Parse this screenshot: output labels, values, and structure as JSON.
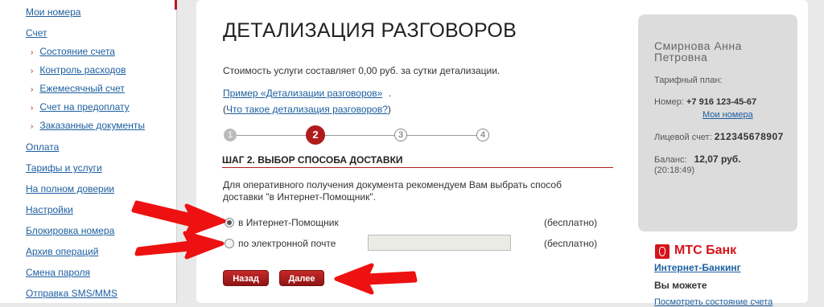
{
  "sidebar": {
    "items": [
      {
        "label": "Мои номера"
      },
      {
        "label": "Счет"
      },
      {
        "label": "Состояние счета"
      },
      {
        "label": "Контроль расходов"
      },
      {
        "label": "Ежемесячный счет"
      },
      {
        "label": "Счет на предоплату"
      },
      {
        "label": "Заказанные документы"
      },
      {
        "label": "Оплата"
      },
      {
        "label": "Тарифы и услуги"
      },
      {
        "label": "На полном доверии"
      },
      {
        "label": "Настройки"
      },
      {
        "label": "Блокировка номера"
      },
      {
        "label": "Архив операций"
      },
      {
        "label": "Смена пароля"
      },
      {
        "label": "Отправка SMS/MMS"
      }
    ]
  },
  "main": {
    "title": "ДЕТАЛИЗАЦИЯ РАЗГОВОРОВ",
    "cost_text": "Стоимость услуги составляет 0,00 руб. за сутки детализации.",
    "example_link": "Пример «Детализации разговоров»",
    "example_suffix": ".",
    "what_is_open": "(",
    "what_is_link": "Что такое детализация разговоров?",
    "what_is_close": ")",
    "steps": [
      "1",
      "2",
      "3",
      "4"
    ],
    "step_title": "ШАГ 2. ВЫБОР СПОСОБА ДОСТАВКИ",
    "recommend_line1": "Для оперативного получения документа рекомендуем Вам выбрать способ",
    "recommend_line2": "доставки \"в Интернет-Помощник\".",
    "options": [
      {
        "label": "в Интернет-Помощник",
        "price": "(бесплатно)",
        "checked": true
      },
      {
        "label": "по электронной почте",
        "price": "(бесплатно)",
        "checked": false
      }
    ],
    "email_value": "",
    "back_label": "Назад",
    "next_label": "Далее"
  },
  "account": {
    "name": "Смирнова Анна Петровна",
    "tariff_label": "Тарифный план:",
    "number_label": "Номер:",
    "number_value": "+7 916 123-45-67",
    "my_numbers_link": "Мои номера",
    "account_label": "Лицевой счет:",
    "account_value": "212345678907",
    "balance_label": "Баланс:",
    "balance_value": "12,07 руб.",
    "balance_time": "(20:18:49)"
  },
  "bank": {
    "name": "МТС Банк",
    "link": "Интернет-Банкинг",
    "can_text": "Вы можете",
    "cut_link": "Посмотреть состояние счета"
  },
  "colors": {
    "accent": "#b01c1c",
    "link": "#1d5fa0",
    "arrow": "#ee1111"
  }
}
